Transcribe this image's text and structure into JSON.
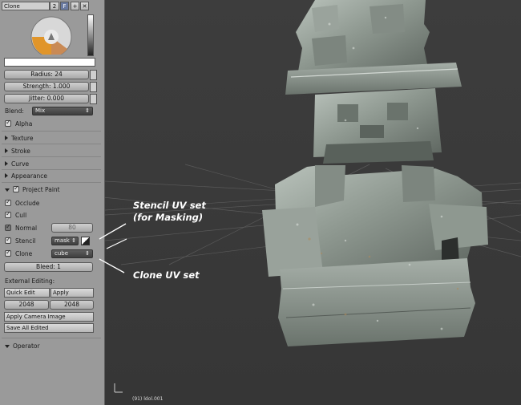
{
  "brush": {
    "name": "Clone",
    "users": "2",
    "f_label": "F",
    "radius": "Radius: 24",
    "strength": "Strength: 1.000",
    "jitter": "Jitter: 0.000",
    "blend_label": "Blend:",
    "blend_value": "Mix",
    "alpha_label": "Alpha"
  },
  "sections": {
    "texture": "Texture",
    "stroke": "Stroke",
    "curve": "Curve",
    "appearance": "Appearance",
    "project_paint": "Project Paint",
    "operator": "Operator"
  },
  "project_paint": {
    "occlude": "Occlude",
    "cull": "Cull",
    "normal": "Normal",
    "normal_value": "80",
    "stencil": "Stencil",
    "stencil_layer": "mask",
    "clone": "Clone",
    "clone_layer": "cube",
    "bleed": "Bleed: 1"
  },
  "external": {
    "heading": "External Editing:",
    "quick_edit": "Quick Edit",
    "apply": "Apply",
    "width": "2048",
    "height": "2048",
    "apply_camera": "Apply Camera Image",
    "save_all": "Save All Edited"
  },
  "viewport": {
    "status": "(91) ldol.001"
  },
  "annotations": {
    "stencil_line1": "Stencil UV set",
    "stencil_line2": "(for Masking)",
    "clone": "Clone UV set"
  },
  "colors": {
    "panel": "#9a9a9a",
    "viewport": "#3a3a3a",
    "annotation": "#ffffff"
  }
}
